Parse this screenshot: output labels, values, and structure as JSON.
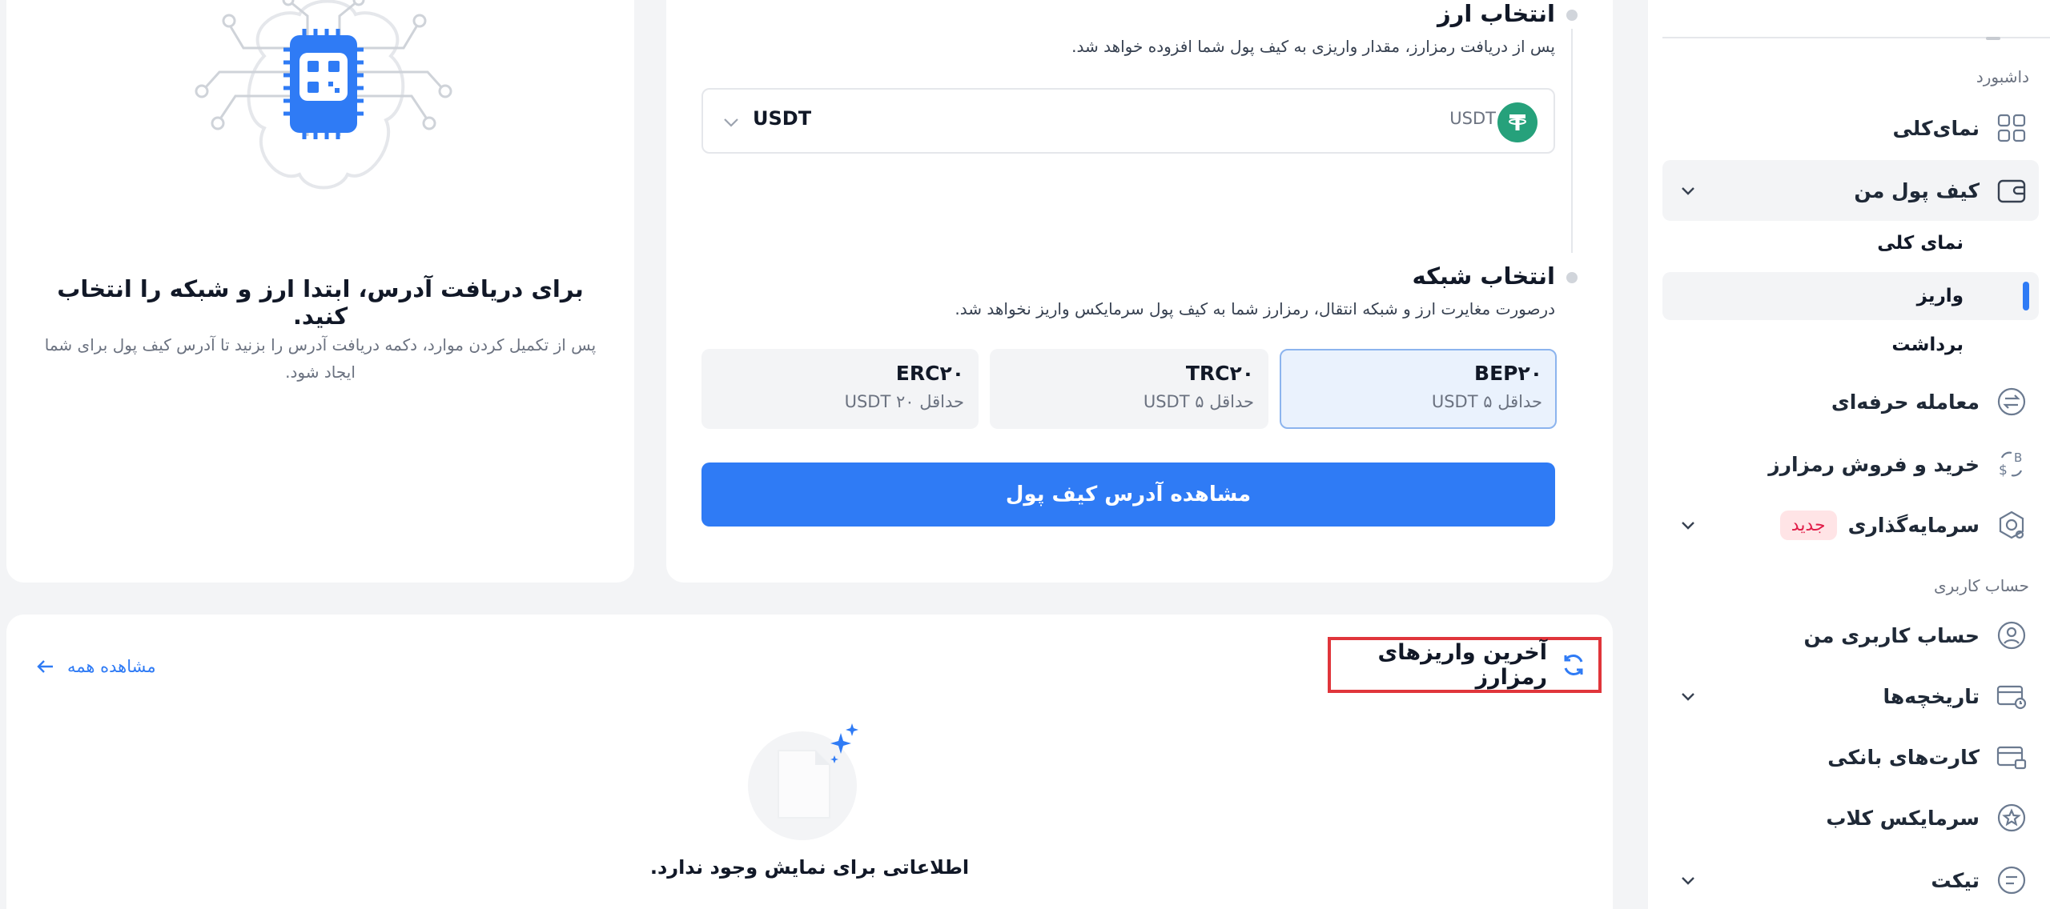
{
  "colors": {
    "accent": "#2f7bf5",
    "tether": "#26a17b",
    "highlight_border": "#e0353b",
    "badge_text": "#e11d48",
    "badge_bg": "#ffe4e6"
  },
  "sidebar": {
    "dashboard_section": "داشبورد",
    "overview": {
      "label": "نمای‌کلی",
      "icon": "grid-icon"
    },
    "wallet": {
      "label": "کیف پول من",
      "icon": "wallet-icon",
      "expanded": true
    },
    "wallet_sub": {
      "overview": "نمای کلی",
      "deposit": "واریز",
      "withdraw": "برداشت"
    },
    "pro_trade": {
      "label": "معامله حرفه‌ای",
      "icon": "exchange-icon"
    },
    "buy_sell": {
      "label": "خرید و فروش رمزارز",
      "icon": "swap-currency-icon"
    },
    "investment": {
      "label": "سرمایه‌گذاری",
      "badge": "جدید",
      "icon": "investment-icon"
    },
    "account_section": "حساب کاربری",
    "my_account": {
      "label": "حساب کاربری من",
      "icon": "user-icon"
    },
    "history": {
      "label": "تاریخچه‌ها",
      "icon": "history-card-icon"
    },
    "bank_cards": {
      "label": "کارت‌های بانکی",
      "icon": "bank-card-icon"
    },
    "club": {
      "label": "سرمایکس کلاب",
      "icon": "star-badge-icon"
    },
    "ticket": {
      "label": "تیکت",
      "icon": "ticket-icon"
    }
  },
  "left_panel": {
    "title": "برای دریافت آدرس، ابتدا ارز و شبکه را انتخاب کنید.",
    "description": "پس از تکمیل کردن موارد، دکمه دریافت آدرس را بزنید تا آدرس کیف پول برای شما ایجاد شود."
  },
  "form": {
    "currency_step": {
      "title": "انتخاب ارز",
      "description": "پس از دریافت رمزارز، مقدار واریزی به کیف پول شما افزوده خواهد شد."
    },
    "currency_select": {
      "value": "USDT",
      "label": "USDT",
      "coin_symbol": "₮"
    },
    "network_step": {
      "title": "انتخاب شبکه",
      "description": "درصورت مغایرت ارز و شبکه انتقال، رمزارز شما به کیف پول سرمایکس واریز نخواهد شد."
    },
    "networks": [
      {
        "name": "BEP۲۰",
        "min": "حداقل ۵ USDT",
        "selected": true
      },
      {
        "name": "TRC۲۰",
        "min": "حداقل ۵ USDT",
        "selected": false
      },
      {
        "name": "ERC۲۰",
        "min": "حداقل ۲۰ USDT",
        "selected": false
      }
    ],
    "submit_label": "مشاهده آدرس کیف پول"
  },
  "recent": {
    "title": "آخرین واریزهای رمزارز",
    "view_all": "مشاهده همه",
    "empty_text": "اطلاعاتی برای نمایش وجود ندارد."
  }
}
